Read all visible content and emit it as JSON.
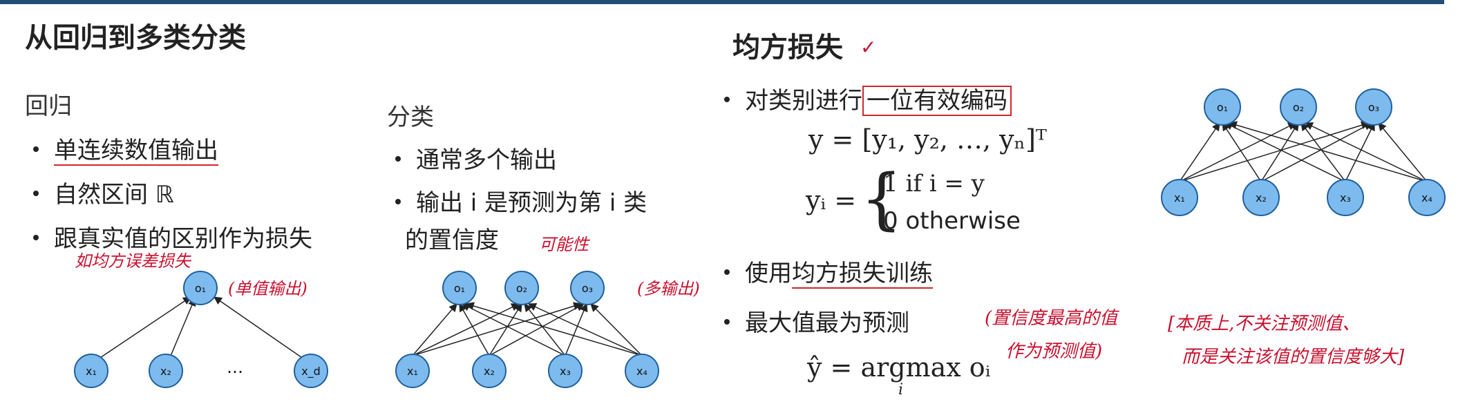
{
  "left_title": "从回归到多类分类",
  "regression": {
    "heading": "回归",
    "bullets": [
      "单连续数值输出",
      "自然区间 ℝ",
      "跟真实值的区别作为损失"
    ],
    "note_under": "如均方误差损失",
    "note_side": "(单值输出)"
  },
  "classification": {
    "heading": "分类",
    "bullets": [
      "通常多个输出",
      "输出 i 是预测为第 i 类"
    ],
    "bullet2_cont": "的置信度",
    "note_prob": "可能性",
    "note_side": "(多输出)"
  },
  "right_title": "均方损失",
  "right_check": "✓",
  "right_bullets": {
    "b1_prefix": "对类别进行",
    "b1_boxed": "一位有效编码",
    "b2_prefix": "使用",
    "b2_underlined": "均方损失训练",
    "b3": "最大值最为预测"
  },
  "formulas": {
    "y_vec": "y = [y₁, y₂, …, yₙ]ᵀ",
    "yi_lhs": "yᵢ =",
    "case1": "1 if i = y",
    "case2": "0 otherwise",
    "argmax": "ŷ = argmax oᵢ",
    "argmax_sub": "i"
  },
  "annotations": {
    "conf_line1": "(置信度最高的值",
    "conf_line2": "作为预测值)",
    "care_line1": "[本质上,不关注预测值、",
    "care_line2": "而是关注该值的置信度够大]"
  },
  "diagrams": {
    "reg_nodes": {
      "o1": "o₁",
      "x1": "x₁",
      "x2": "x₂",
      "ellipsis": "…",
      "xd": "x_d"
    },
    "cls_nodes": {
      "o1": "o₁",
      "o2": "o₂",
      "o3": "o₃",
      "x1": "x₁",
      "x2": "x₂",
      "x3": "x₃",
      "x4": "x₄"
    },
    "right_nodes": {
      "o1": "o₁",
      "o2": "o₂",
      "o3": "o₃",
      "x1": "x₁",
      "x2": "x₂",
      "x3": "x₃",
      "x4": "x₄"
    }
  },
  "colors": {
    "node_fill": "#7dbbef",
    "node_stroke": "#1f5f9c",
    "accent": "#d0252b",
    "topbar": "#1f4e79"
  }
}
